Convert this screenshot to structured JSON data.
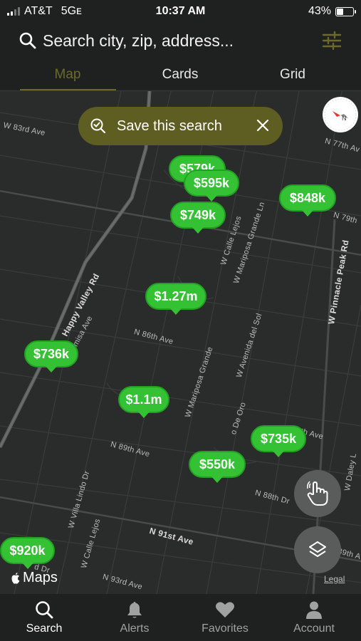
{
  "status_bar": {
    "carrier": "AT&T",
    "network": "5Gᴇ",
    "time": "10:37 AM",
    "battery": "43%",
    "battery_level": 0.43
  },
  "search": {
    "placeholder": "Search city, zip, address..."
  },
  "tabs": [
    {
      "label": "Map"
    },
    {
      "label": "Cards"
    },
    {
      "label": "Grid"
    }
  ],
  "save_search": {
    "label": "Save this search"
  },
  "streets": [
    "W 83rd Ave",
    "Happy Valley Rd",
    "misa Ave",
    "N 86th Ave",
    "W Mariposa Grande",
    "W Calle Lejos",
    "W Mariposa Grande Ln",
    "W Avenida del Sol",
    "W Pinnacle Peak Rd",
    "N 77th Av",
    "N 79th",
    "N 89th Ave",
    "W Villa Lindo Dr",
    "W Calle Lejos",
    "N 91st Ave",
    "N 93rd Ave",
    "N 88th Dr",
    "o De Oro",
    "8th Ave",
    "39th A",
    "W Daley L",
    "d Dr"
  ],
  "listings": [
    {
      "price": "$579k"
    },
    {
      "price": "$595k"
    },
    {
      "price": "$749k"
    },
    {
      "price": "$848k"
    },
    {
      "price": "$1.27m"
    },
    {
      "price": "$736k"
    },
    {
      "price": "$1.1m"
    },
    {
      "price": "$735k"
    },
    {
      "price": "$550k"
    },
    {
      "price": "$920k"
    }
  ],
  "map_attribution": {
    "brand": "Maps",
    "legal": "Legal"
  },
  "bottom_nav": [
    {
      "label": "Search",
      "icon": "search-icon"
    },
    {
      "label": "Alerts",
      "icon": "bell-icon"
    },
    {
      "label": "Favorites",
      "icon": "heart-icon"
    },
    {
      "label": "Account",
      "icon": "person-icon"
    }
  ],
  "colors": {
    "pin_green": "#34c234",
    "accent_olive": "#6b6a2c",
    "save_pill": "#5f5e22",
    "background": "#1f2120"
  }
}
